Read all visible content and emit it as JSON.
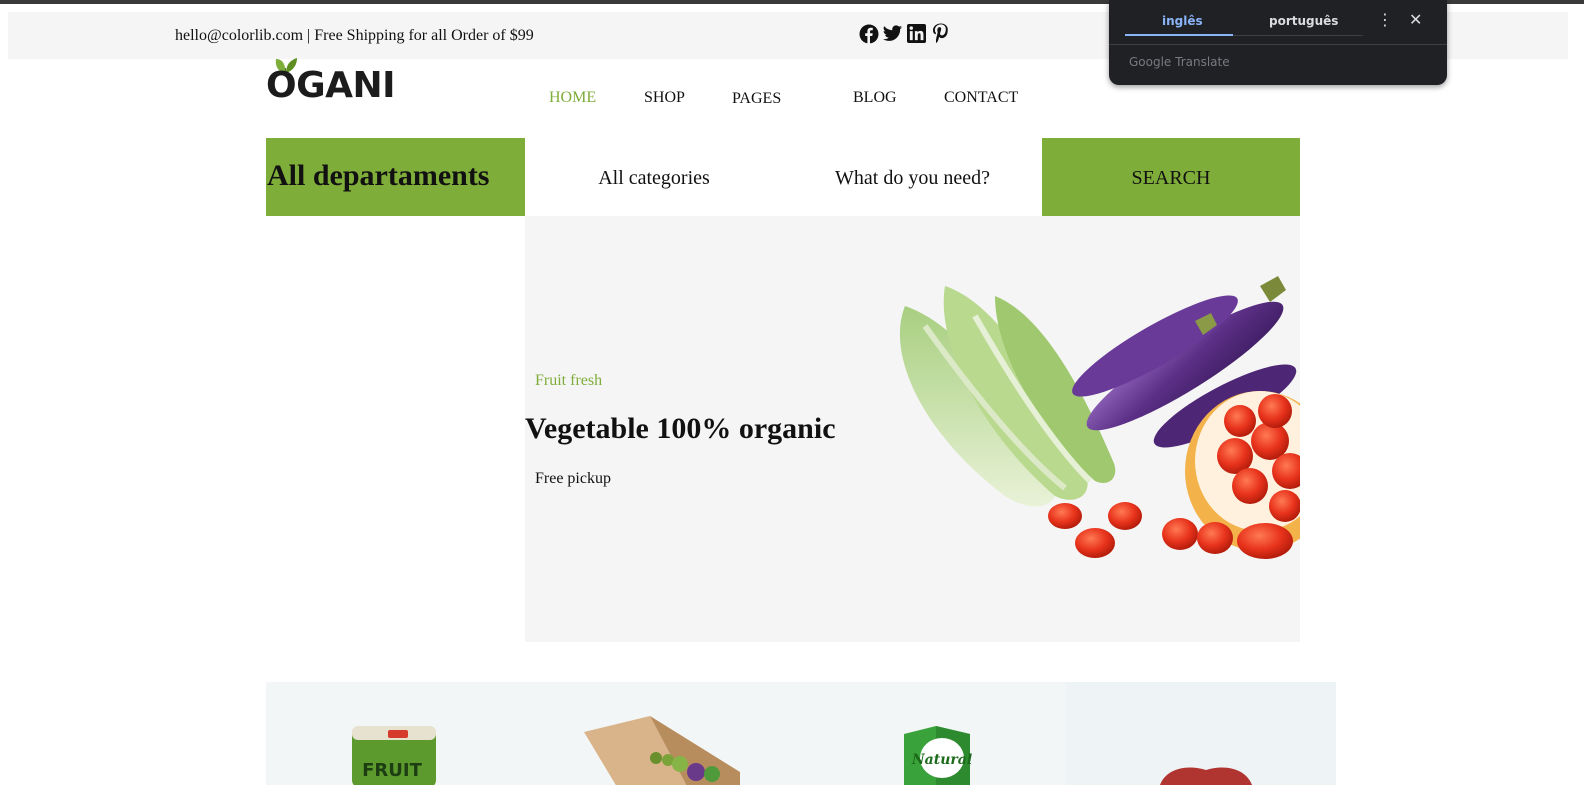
{
  "header": {
    "info_text": "hello@colorlib.com | Free Shipping for all Order of $99",
    "social_icons": [
      "facebook-icon",
      "twitter-icon",
      "linkedin-icon",
      "pinterest-icon"
    ]
  },
  "logo": {
    "text": "OGANI"
  },
  "nav": {
    "items": [
      {
        "label": "HOME",
        "active": true
      },
      {
        "label": "SHOP"
      },
      {
        "label": "PAGES"
      },
      {
        "label": "BLOG"
      },
      {
        "label": "CONTACT"
      }
    ]
  },
  "search_bar": {
    "departments_label": "All departaments",
    "categories_label": "All categories",
    "placeholder": "What do you need?",
    "button_label": "SEARCH"
  },
  "hero": {
    "tag": "Fruit fresh",
    "title": "Vegetable 100% organic",
    "subtitle": "Free pickup"
  },
  "translate_popup": {
    "tab_source": "inglês",
    "tab_target": "português",
    "brand": "Google Translate"
  },
  "colors": {
    "accent": "#7fad39",
    "topbar_bg": "#f5f5f5",
    "hero_bg": "#f5f5f5",
    "popup_bg": "#202124",
    "popup_active": "#8ab4f8"
  }
}
